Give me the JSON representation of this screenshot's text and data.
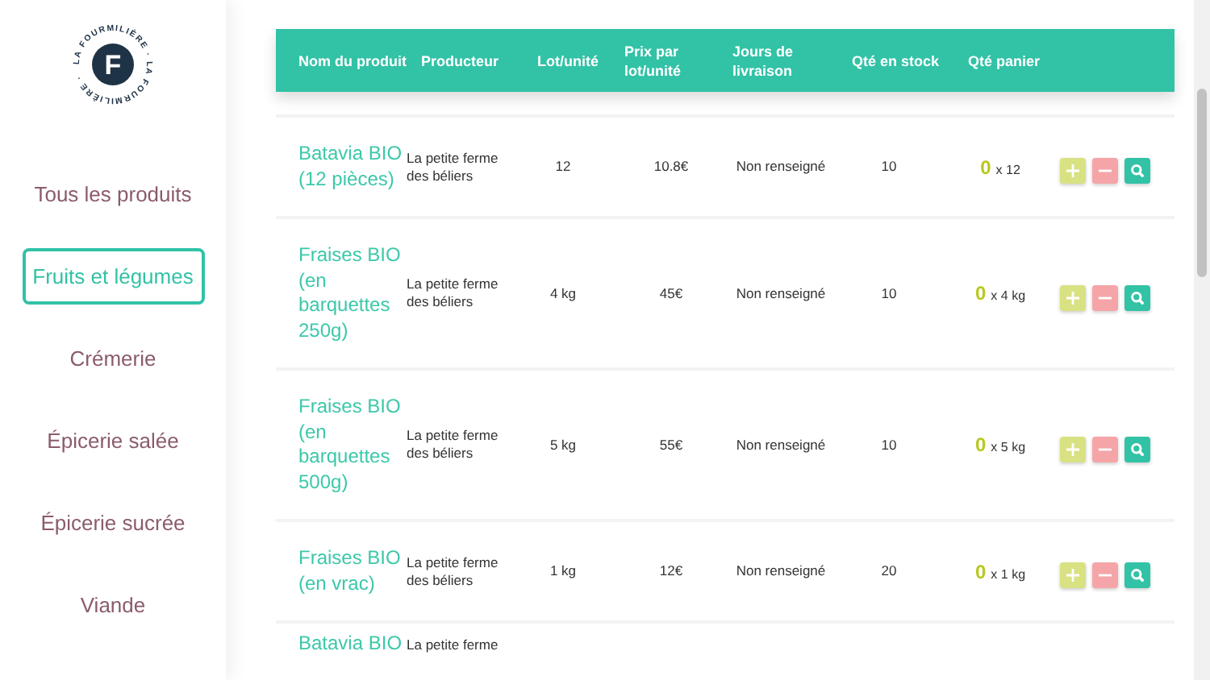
{
  "logo": {
    "ring_text": "LA FOURMILIÈRE · LA FOURMILIÈRE ·",
    "letter": "F"
  },
  "sidebar": {
    "items": [
      {
        "label": "Tous les produits",
        "selected": false
      },
      {
        "label": "Fruits et légumes",
        "selected": true
      },
      {
        "label": "Crémerie",
        "selected": false
      },
      {
        "label": "Épicerie salée",
        "selected": false
      },
      {
        "label": "Épicerie sucrée",
        "selected": false
      },
      {
        "label": "Viande",
        "selected": false
      }
    ]
  },
  "table": {
    "columns": [
      "Nom du produit",
      "Producteur",
      "Lot/unité",
      "Prix par lot/unité",
      "Jours de livraison",
      "Qté en stock",
      "Qté panier"
    ],
    "rows": [
      {
        "name": "Batavia BIO (12 pièces)",
        "producer": "La petite ferme des béliers",
        "lot": "12",
        "price": "10.8€",
        "days": "Non renseigné",
        "stock": "10",
        "qty": "0",
        "unit": "x 12"
      },
      {
        "name": "Fraises BIO (en barquettes 250g)",
        "producer": "La petite ferme des béliers",
        "lot": "4 kg",
        "price": "45€",
        "days": "Non renseigné",
        "stock": "10",
        "qty": "0",
        "unit": "x 4 kg"
      },
      {
        "name": "Fraises BIO (en barquettes 500g)",
        "producer": "La petite ferme des béliers",
        "lot": "5 kg",
        "price": "55€",
        "days": "Non renseigné",
        "stock": "10",
        "qty": "0",
        "unit": "x 5 kg"
      },
      {
        "name": "Fraises BIO (en vrac)",
        "producer": "La petite ferme des béliers",
        "lot": "1 kg",
        "price": "12€",
        "days": "Non renseigné",
        "stock": "20",
        "qty": "0",
        "unit": "x 1 kg"
      }
    ],
    "partial_row": {
      "name": "Batavia BIO",
      "producer": "La petite ferme"
    }
  }
}
